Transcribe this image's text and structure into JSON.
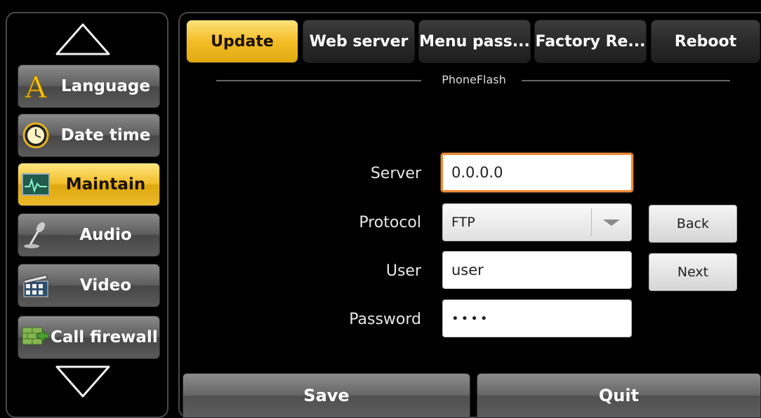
{
  "sidebar": {
    "items": [
      {
        "label": "Language",
        "icon": "letter-a-icon"
      },
      {
        "label": "Date time",
        "icon": "clock-icon"
      },
      {
        "label": "Maintain",
        "icon": "monitor-icon",
        "active": true
      },
      {
        "label": "Audio",
        "icon": "microphone-icon"
      },
      {
        "label": "Video",
        "icon": "clapperboard-icon"
      },
      {
        "label": "Call firewall",
        "icon": "firewall-icon"
      }
    ]
  },
  "tabs": [
    {
      "label": "Update",
      "active": true
    },
    {
      "label": "Web server"
    },
    {
      "label": "Menu pass..."
    },
    {
      "label": "Factory Re..."
    },
    {
      "label": "Reboot"
    }
  ],
  "section": {
    "title": "PhoneFlash"
  },
  "form": {
    "server": {
      "label": "Server",
      "value": "0.0.0.0"
    },
    "protocol": {
      "label": "Protocol",
      "value": "FTP"
    },
    "user": {
      "label": "User",
      "value": "user"
    },
    "password": {
      "label": "Password",
      "value": "••••"
    }
  },
  "buttons": {
    "back": "Back",
    "next": "Next",
    "save": "Save",
    "quit": "Quit"
  },
  "colors": {
    "accent": "#f3bd27",
    "focus_border": "#f08a35",
    "background": "#000000"
  }
}
